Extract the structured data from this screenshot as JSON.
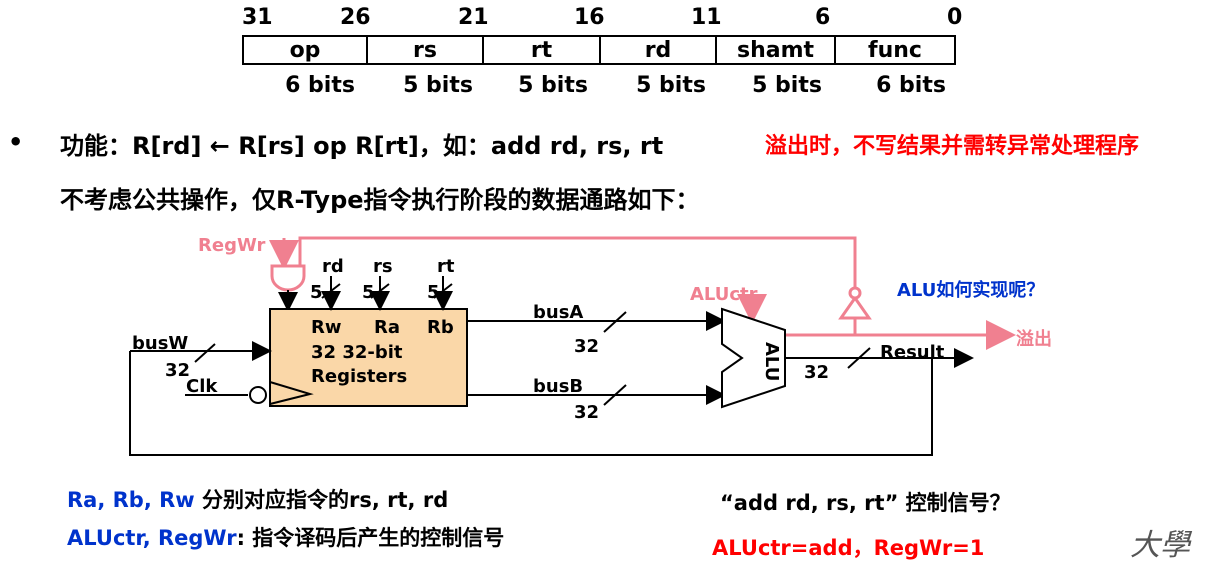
{
  "bit_positions": [
    "31",
    "26",
    "21",
    "16",
    "11",
    "6",
    "0"
  ],
  "fields": [
    {
      "name": "op",
      "bits": "6 bits"
    },
    {
      "name": "rs",
      "bits": "5 bits"
    },
    {
      "name": "rt",
      "bits": "5 bits"
    },
    {
      "name": "rd",
      "bits": "5 bits"
    },
    {
      "name": "shamt",
      "bits": "5 bits"
    },
    {
      "name": "func",
      "bits": "6 bits"
    }
  ],
  "bullet": "•",
  "function_text": "功能：R[rd] ← R[rs] op R[rt]，如：add    rd, rs, rt",
  "overflow_note": "溢出时，不写结果并需转异常处理程序",
  "datapath_intro": "不考虑公共操作，仅R-Type指令执行阶段的数据通路如下：",
  "diagram": {
    "regwr": "RegWr",
    "rd": "rd",
    "rs": "rs",
    "rt": "rt",
    "five": "5",
    "rw": "Rw",
    "ra": "Ra",
    "rb": "Rb",
    "reg_line1": "32 32-bit",
    "reg_line2": "Registers",
    "busw": "busW",
    "thirty_two": "32",
    "clk": "Clk",
    "busa": "busA",
    "busb": "busB",
    "aluctr": "ALUctr",
    "alu": "ALU",
    "result": "Result",
    "overflow": "溢出",
    "alu_question": "ALU如何实现呢？"
  },
  "footer": {
    "left1_blue": "Ra, Rb, Rw",
    "left1_black": " 分别对应指令的rs, rt, rd",
    "left2_blue": "ALUctr, RegWr",
    "left2_black": ":  指令译码后产生的控制信号",
    "right_question": "“add rd, rs, rt” 控制信号？",
    "right_answer": "ALUctr=add，RegWr=1",
    "logo": "大學"
  },
  "colors": {
    "red": "#ff0000",
    "blue": "#0033cc",
    "pink": "#f08090",
    "register_fill": "#fad7a8"
  }
}
